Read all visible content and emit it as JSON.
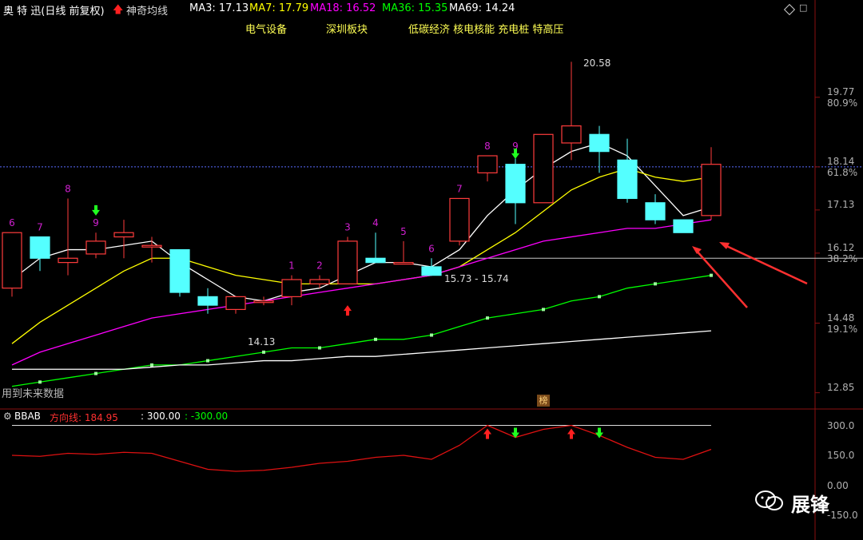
{
  "header": {
    "title": "奥 特 迅(日线 前复权)",
    "indicator": "神奇均线",
    "ma": [
      {
        "label": "MA3: 17.13",
        "color": "#ffffff"
      },
      {
        "label": "MA7: 17.79",
        "color": "#ffff00"
      },
      {
        "label": "MA18: 16.52",
        "color": "#ff00ff"
      },
      {
        "label": "MA36: 15.35",
        "color": "#00ff00"
      },
      {
        "label": "MA69: 14.24",
        "color": "#ffffff"
      }
    ]
  },
  "tags": [
    "电气设备",
    "深圳板块",
    "低碳经济 核电核能 充电桩 特高压"
  ],
  "annotations": {
    "high": "20.58",
    "low": "14.13",
    "range": "15.73 - 15.74",
    "future_note": "用到未来数据",
    "bang": "榜"
  },
  "sub_header": {
    "name": "BBAB",
    "direction": "方向线: 184.95",
    "upper": ": 300.00",
    "lower": ": -300.00"
  },
  "watermark": "展锋",
  "colors": {
    "up": "#ff3c3c",
    "down": "#54ffff",
    "bg": "#000000"
  },
  "chart_data": [
    {
      "type": "candlestick",
      "ylim": [
        12.6,
        21.3
      ],
      "y_ticks": [
        {
          "price": "19.77",
          "pct": "80.9%"
        },
        {
          "price": "18.14",
          "pct": "61.8%"
        },
        {
          "price": "17.13",
          "pct": ""
        },
        {
          "price": "16.12",
          "pct": "38.2%"
        },
        {
          "price": "14.48",
          "pct": "19.1%"
        },
        {
          "price": "12.85",
          "pct": ""
        }
      ],
      "candles": [
        {
          "o": 15.3,
          "h": 16.6,
          "l": 15.1,
          "c": 16.6
        },
        {
          "o": 16.5,
          "h": 16.5,
          "l": 15.7,
          "c": 16.0
        },
        {
          "o": 15.9,
          "h": 17.4,
          "l": 15.6,
          "c": 16.0
        },
        {
          "o": 16.1,
          "h": 16.6,
          "l": 16.0,
          "c": 16.4
        },
        {
          "o": 16.5,
          "h": 16.9,
          "l": 16.0,
          "c": 16.6
        },
        {
          "o": 16.3,
          "h": 16.5,
          "l": 15.9,
          "c": 16.3
        },
        {
          "o": 16.2,
          "h": 16.2,
          "l": 15.1,
          "c": 15.2
        },
        {
          "o": 15.1,
          "h": 15.3,
          "l": 14.7,
          "c": 14.9
        },
        {
          "o": 14.8,
          "h": 15.1,
          "l": 14.7,
          "c": 15.1
        },
        {
          "o": 15.0,
          "h": 15.1,
          "l": 14.9,
          "c": 15.0
        },
        {
          "o": 15.1,
          "h": 15.6,
          "l": 14.9,
          "c": 15.5
        },
        {
          "o": 15.4,
          "h": 15.6,
          "l": 15.3,
          "c": 15.5
        },
        {
          "o": 15.4,
          "h": 16.5,
          "l": 15.4,
          "c": 16.4
        },
        {
          "o": 16.0,
          "h": 16.6,
          "l": 15.9,
          "c": 15.9
        },
        {
          "o": 15.9,
          "h": 16.4,
          "l": 15.9,
          "c": 15.9
        },
        {
          "o": 15.8,
          "h": 16.0,
          "l": 15.6,
          "c": 15.6
        },
        {
          "o": 16.4,
          "h": 17.4,
          "l": 16.3,
          "c": 17.4
        },
        {
          "o": 18.0,
          "h": 18.4,
          "l": 17.8,
          "c": 18.4
        },
        {
          "o": 18.2,
          "h": 18.4,
          "l": 16.8,
          "c": 17.3
        },
        {
          "o": 17.3,
          "h": 18.9,
          "l": 17.3,
          "c": 18.9
        },
        {
          "o": 18.7,
          "h": 20.6,
          "l": 18.3,
          "c": 19.1
        },
        {
          "o": 18.9,
          "h": 19.1,
          "l": 18.0,
          "c": 18.5
        },
        {
          "o": 18.3,
          "h": 18.8,
          "l": 17.3,
          "c": 17.4
        },
        {
          "o": 17.3,
          "h": 17.5,
          "l": 16.8,
          "c": 16.9
        },
        {
          "o": 16.9,
          "h": 16.9,
          "l": 16.6,
          "c": 16.6
        },
        {
          "o": 17.0,
          "h": 18.6,
          "l": 16.9,
          "c": 18.2
        }
      ],
      "candle_labels": [
        "6",
        "7",
        "8",
        "9",
        "",
        "",
        "",
        "",
        "",
        "",
        "1",
        "2",
        "3",
        "4",
        "5",
        "6",
        "7",
        "8",
        "9",
        "",
        "",
        "",
        "",
        "",
        "",
        ""
      ],
      "ma_lines": [
        {
          "name": "MA3",
          "color": "#ffffff",
          "values": [
            15.5,
            16.0,
            16.2,
            16.2,
            16.3,
            16.4,
            15.9,
            15.5,
            15.1,
            15.0,
            15.2,
            15.3,
            15.6,
            15.9,
            15.9,
            15.8,
            16.2,
            17.0,
            17.6,
            18.1,
            18.5,
            18.7,
            18.4,
            17.7,
            17.0,
            17.2
          ]
        },
        {
          "name": "MA7",
          "color": "#ffff00",
          "values": [
            14.0,
            14.5,
            14.9,
            15.3,
            15.7,
            16.0,
            16.0,
            15.8,
            15.6,
            15.5,
            15.4,
            15.4,
            15.4,
            15.4,
            15.5,
            15.6,
            15.8,
            16.2,
            16.6,
            17.1,
            17.6,
            17.9,
            18.1,
            17.9,
            17.8,
            17.9
          ]
        },
        {
          "name": "MA18",
          "color": "#ff00ff",
          "values": [
            13.5,
            13.8,
            14.0,
            14.2,
            14.4,
            14.6,
            14.7,
            14.8,
            14.9,
            15.0,
            15.1,
            15.2,
            15.3,
            15.4,
            15.5,
            15.6,
            15.8,
            16.0,
            16.2,
            16.4,
            16.5,
            16.6,
            16.7,
            16.7,
            16.8,
            16.9
          ]
        },
        {
          "name": "MA36",
          "color": "#00ff00",
          "values": [
            13.0,
            13.1,
            13.2,
            13.3,
            13.4,
            13.5,
            13.5,
            13.6,
            13.7,
            13.8,
            13.9,
            13.9,
            14.0,
            14.1,
            14.1,
            14.2,
            14.4,
            14.6,
            14.7,
            14.8,
            15.0,
            15.1,
            15.3,
            15.4,
            15.5,
            15.6
          ]
        },
        {
          "name": "MA69",
          "color": "#ffffff",
          "values": [
            13.4,
            13.4,
            13.4,
            13.4,
            13.4,
            13.45,
            13.5,
            13.5,
            13.55,
            13.6,
            13.6,
            13.65,
            13.7,
            13.7,
            13.75,
            13.8,
            13.85,
            13.9,
            13.95,
            14.0,
            14.05,
            14.1,
            14.15,
            14.2,
            14.25,
            14.3
          ]
        }
      ],
      "h_lines": [
        18.14,
        16.0
      ]
    },
    {
      "type": "line",
      "title": "BBAB",
      "ylim": [
        -250,
        350
      ],
      "y_ticks": [
        "300.0",
        "150.0",
        "0.00",
        "-150.0"
      ],
      "series": [
        {
          "name": "方向线",
          "color": "#dd1111",
          "values": [
            150,
            145,
            160,
            155,
            165,
            160,
            120,
            80,
            70,
            75,
            90,
            110,
            120,
            140,
            150,
            130,
            200,
            300,
            240,
            280,
            300,
            250,
            190,
            140,
            130,
            180
          ]
        }
      ],
      "constant_lines": [
        300,
        -300
      ],
      "up_arrows": [
        17,
        20
      ],
      "down_arrows": [
        18,
        21
      ]
    }
  ]
}
